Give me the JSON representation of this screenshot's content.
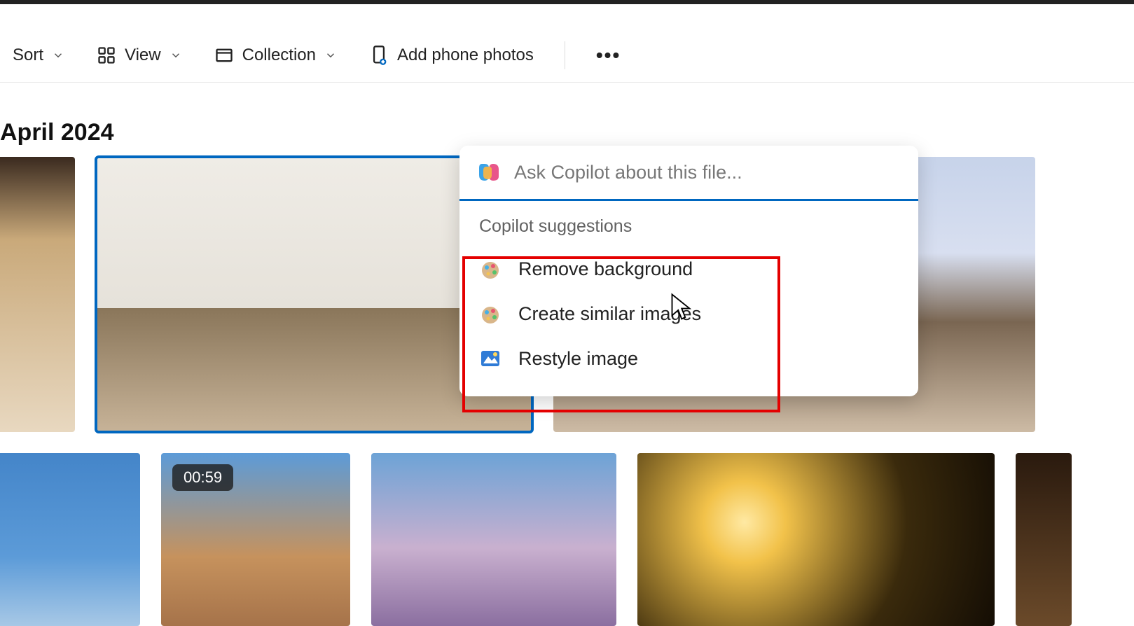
{
  "toolbar": {
    "sort_label": "Sort",
    "view_label": "View",
    "collection_label": "Collection",
    "add_phone_label": "Add phone photos"
  },
  "section": {
    "heading": "April 2024"
  },
  "thumbnails": {
    "video_badge": "00:59"
  },
  "copilot": {
    "input_placeholder": "Ask Copilot about this file...",
    "suggestions_label": "Copilot suggestions",
    "suggestions": [
      {
        "label": "Remove background",
        "icon": "paint"
      },
      {
        "label": "Create similar images",
        "icon": "paint"
      },
      {
        "label": "Restyle image",
        "icon": "picture"
      }
    ]
  }
}
